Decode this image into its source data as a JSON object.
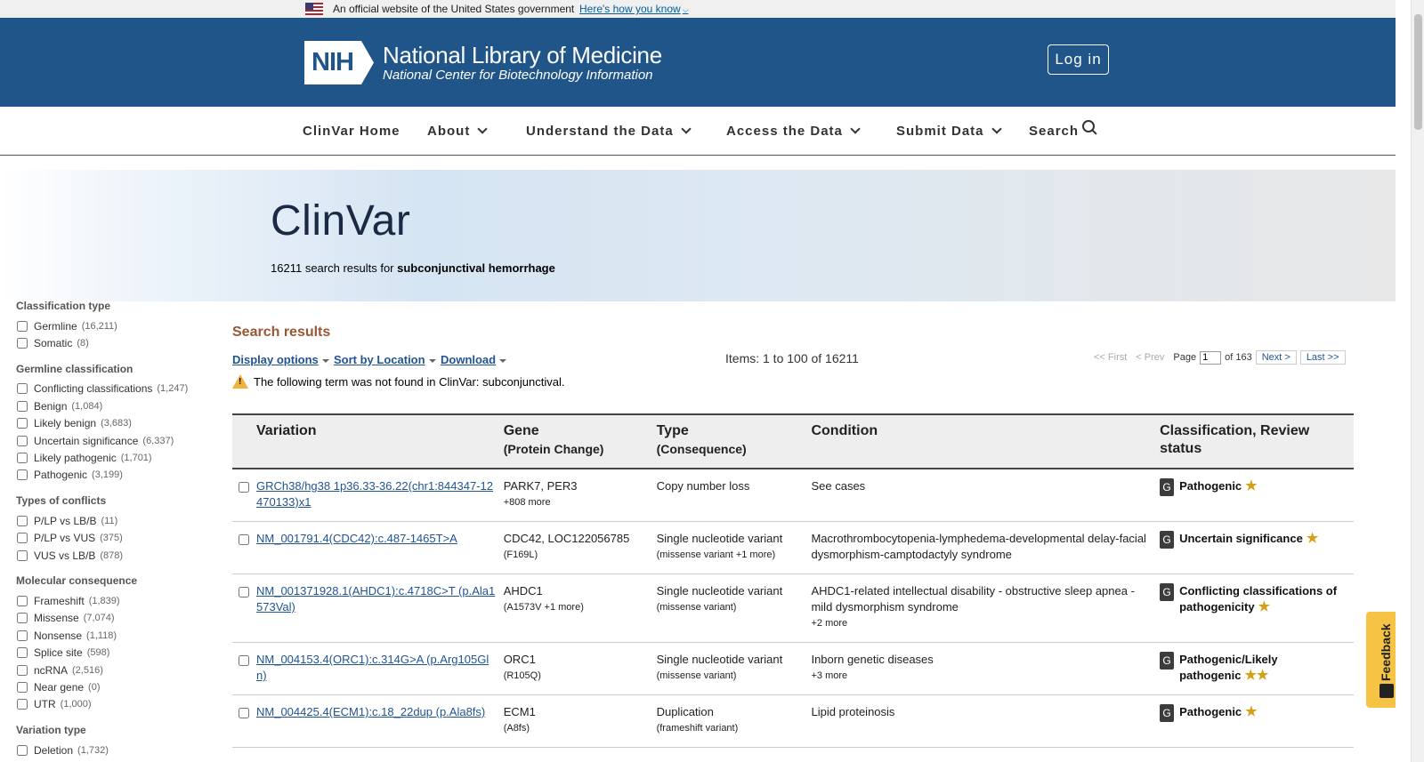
{
  "gov_banner": {
    "text": "An official website of the United States government",
    "link": "Here's how you know"
  },
  "header": {
    "logo_badge": "NIH",
    "org_name": "National Library of Medicine",
    "org_sub": "National Center for Biotechnology Information",
    "login_label": "Log in"
  },
  "nav": {
    "home": "ClinVar Home",
    "about": "About",
    "understand": "Understand the Data",
    "access": "Access the Data",
    "submit": "Submit Data",
    "search": "Search"
  },
  "hero": {
    "title": "ClinVar",
    "count": "16211",
    "summary_text": "search results for",
    "query": "subconjunctival hemorrhage"
  },
  "sidebar": {
    "groups": [
      {
        "title": "Classification type",
        "options": [
          {
            "label": "Germline",
            "count": "(16,211)"
          },
          {
            "label": "Somatic",
            "count": "(8)"
          }
        ]
      },
      {
        "title": "Germline classification",
        "options": [
          {
            "label": "Conflicting classifications",
            "count": "(1,247)"
          },
          {
            "label": "Benign",
            "count": "(1,084)"
          },
          {
            "label": "Likely benign",
            "count": "(3,683)"
          },
          {
            "label": "Uncertain significance",
            "count": "(6,337)"
          },
          {
            "label": "Likely pathogenic",
            "count": "(1,701)"
          },
          {
            "label": "Pathogenic",
            "count": "(3,199)"
          }
        ]
      },
      {
        "title": "Types of conflicts",
        "options": [
          {
            "label": "P/LP vs LB/B",
            "count": "(11)"
          },
          {
            "label": "P/LP vs VUS",
            "count": "(375)"
          },
          {
            "label": "VUS vs LB/B",
            "count": "(878)"
          }
        ]
      },
      {
        "title": "Molecular consequence",
        "options": [
          {
            "label": "Frameshift",
            "count": "(1,839)"
          },
          {
            "label": "Missense",
            "count": "(7,074)"
          },
          {
            "label": "Nonsense",
            "count": "(1,118)"
          },
          {
            "label": "Splice site",
            "count": "(598)"
          },
          {
            "label": "ncRNA",
            "count": "(2,516)"
          },
          {
            "label": "Near gene",
            "count": "(0)"
          },
          {
            "label": "UTR",
            "count": "(1,000)"
          }
        ]
      },
      {
        "title": "Variation type",
        "options": [
          {
            "label": "Deletion",
            "count": "(1,732)"
          }
        ]
      }
    ]
  },
  "results": {
    "heading": "Search results",
    "display_options": "Display options",
    "sort": "Sort by Location",
    "download": "Download",
    "items_text": "Items: 1 to 100 of 16211",
    "pager": {
      "first": "<< First",
      "prev": "< Prev",
      "page_label": "Page",
      "page_value": "1",
      "of_text": "of 163",
      "next": "Next >",
      "last": "Last >>"
    },
    "warning": "The following term was not found in ClinVar: subconjunctival.",
    "columns": {
      "variation": "Variation",
      "gene": "Gene",
      "gene_sub": "(Protein Change)",
      "type": "Type",
      "type_sub": "(Consequence)",
      "condition": "Condition",
      "classification": "Classification, Review status"
    },
    "rows": [
      {
        "variation": "GRCh38/hg38 1p36.33-36.22(chr1:844347-12470133)x1",
        "gene": "PARK7, PER3",
        "gene_extra": "+808 more",
        "type": "Copy number loss",
        "type_extra": "",
        "condition": "See cases",
        "condition_extra": "",
        "badge": "G",
        "classification": "Pathogenic",
        "stars": "★"
      },
      {
        "variation": "NM_001791.4(CDC42):c.487-1465T>A",
        "gene": "CDC42, LOC122056785",
        "gene_extra": "(F169L)",
        "type": "Single nucleotide variant",
        "type_extra": "(missense variant +1 more)",
        "condition": "Macrothrombocytopenia-lymphedema-developmental delay-facial dysmorphism-camptodactyly syndrome",
        "condition_extra": "",
        "badge": "G",
        "classification": "Uncertain significance",
        "stars": "★"
      },
      {
        "variation": "NM_001371928.1(AHDC1):c.4718C>T (p.Ala1573Val)",
        "gene": "AHDC1",
        "gene_extra": "(A1573V +1 more)",
        "type": "Single nucleotide variant",
        "type_extra": "(missense variant)",
        "condition": "AHDC1-related intellectual disability - obstructive sleep apnea - mild dysmorphism syndrome",
        "condition_extra": "+2 more",
        "badge": "G",
        "classification": "Conflicting classifications of pathogenicity",
        "stars": "★"
      },
      {
        "variation": "NM_004153.4(ORC1):c.314G>A (p.Arg105Gln)",
        "gene": "ORC1",
        "gene_extra": "(R105Q)",
        "type": "Single nucleotide variant",
        "type_extra": "(missense variant)",
        "condition": "Inborn genetic diseases",
        "condition_extra": "+3 more",
        "badge": "G",
        "classification": "Pathogenic/Likely pathogenic",
        "stars": "★★"
      },
      {
        "variation": "NM_004425.4(ECM1):c.18_22dup (p.Ala8fs)",
        "gene": "ECM1",
        "gene_extra": "(A8fs)",
        "type": "Duplication",
        "type_extra": "(frameshift variant)",
        "condition": "Lipid proteinosis",
        "condition_extra": "",
        "badge": "G",
        "classification": "Pathogenic",
        "stars": "★"
      }
    ]
  },
  "feedback_label": "Feedback"
}
